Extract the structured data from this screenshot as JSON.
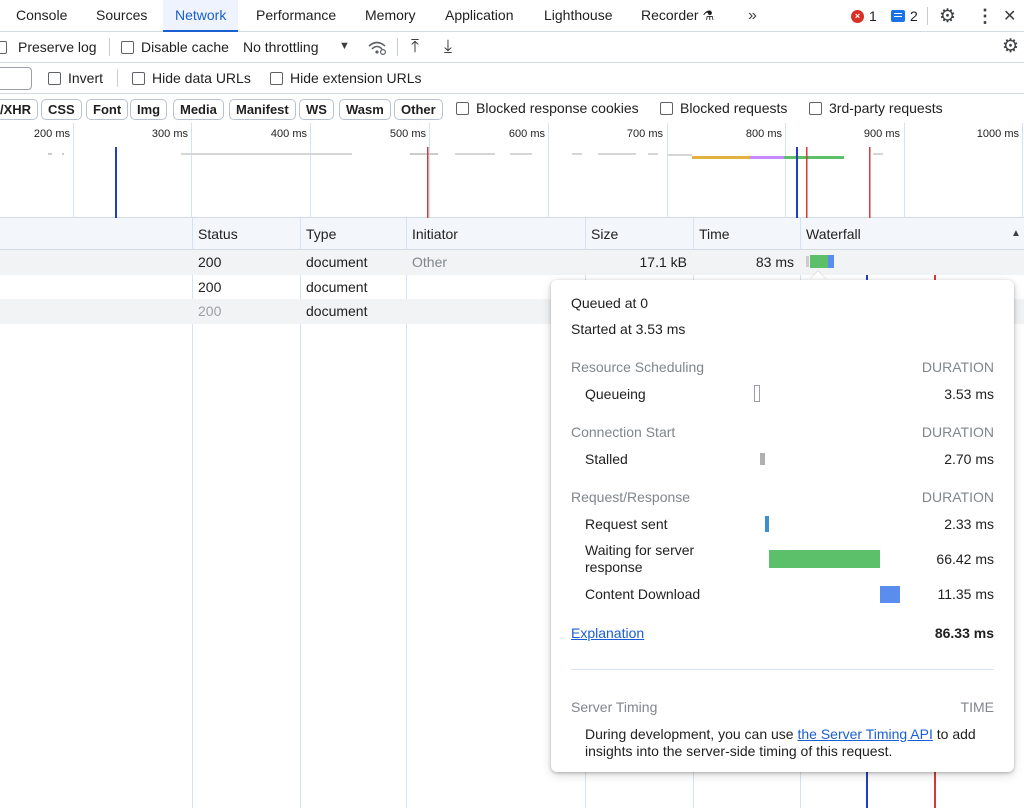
{
  "tabs": [
    {
      "label": "Console",
      "active": false
    },
    {
      "label": "Sources",
      "active": false
    },
    {
      "label": "Network",
      "active": true
    },
    {
      "label": "Performance",
      "active": false
    },
    {
      "label": "Memory",
      "active": false
    },
    {
      "label": "Application",
      "active": false
    },
    {
      "label": "Lighthouse",
      "active": false
    },
    {
      "label": "Recorder",
      "active": false
    }
  ],
  "tabbar": {
    "more_glyph": "»",
    "errors": "1",
    "messages": "2",
    "error_glyph": "×",
    "settings_glyph": "⚙",
    "kebab_glyph": "⋮",
    "close_glyph": "✕",
    "recorder_glyph": "⚗"
  },
  "toolbar": {
    "preserve_log": "Preserve log",
    "disable_cache": "Disable cache",
    "throttling": "No throttling",
    "dropdown_glyph": "▼",
    "upload_glyph": "⤒",
    "download_glyph": "⤓",
    "settings_glyph": "⚙"
  },
  "filter": {
    "invert": "Invert",
    "hide_data_urls": "Hide data URLs",
    "hide_extension_urls": "Hide extension URLs"
  },
  "type_chips": [
    "/XHR",
    "CSS",
    "Font",
    "Img",
    "Media",
    "Manifest",
    "WS",
    "Wasm",
    "Other"
  ],
  "type_checks": {
    "blocked_cookies": "Blocked response cookies",
    "blocked_requests": "Blocked requests",
    "third_party": "3rd-party requests"
  },
  "overview_ticks": [
    "200 ms",
    "300 ms",
    "400 ms",
    "500 ms",
    "600 ms",
    "700 ms",
    "800 ms",
    "900 ms",
    "1000 ms"
  ],
  "columns": {
    "status": "Status",
    "type": "Type",
    "initiator": "Initiator",
    "size": "Size",
    "time": "Time",
    "waterfall": "Waterfall",
    "sort_glyph": "▲"
  },
  "rows": [
    {
      "status": "200",
      "type": "document",
      "initiator": "Other",
      "size": "17.1 kB",
      "time": "83 ms"
    },
    {
      "status": "200",
      "type": "document",
      "initiator": "",
      "size": "",
      "time": ""
    },
    {
      "status": "200",
      "type": "document",
      "initiator": "",
      "size": "",
      "time": ""
    }
  ],
  "timing": {
    "queued_at": "Queued at 0",
    "started_at": "Started at 3.53 ms",
    "duration_label": "DURATION",
    "sections": {
      "scheduling": "Resource Scheduling",
      "connection": "Connection Start",
      "request": "Request/Response"
    },
    "entries": {
      "queueing": {
        "label": "Queueing",
        "value": "3.53 ms"
      },
      "stalled": {
        "label": "Stalled",
        "value": "2.70 ms"
      },
      "request_sent": {
        "label": "Request sent",
        "value": "2.33 ms"
      },
      "waiting_line1": "Waiting for server",
      "waiting_line2": "response",
      "waiting_value": "66.42 ms",
      "content_download": {
        "label": "Content Download",
        "value": "11.35 ms"
      }
    },
    "explanation": "Explanation",
    "total": "86.33 ms",
    "server_timing": {
      "title": "Server Timing",
      "time_label": "TIME",
      "line1_prefix": "During development, you can use ",
      "link": "the Server Timing API",
      "line1_suffix": " to add",
      "line2": "insights into the server-side timing of this request."
    }
  },
  "colors": {
    "accent": "#1a5fd1",
    "waiting_green": "#5cbf6a",
    "download_blue": "#5b8def",
    "request_blue": "#3d8ed1",
    "stalled_gray": "#b0b0b0",
    "dom_content_line": "#1f3fbf",
    "load_line": "#d33a3a"
  }
}
